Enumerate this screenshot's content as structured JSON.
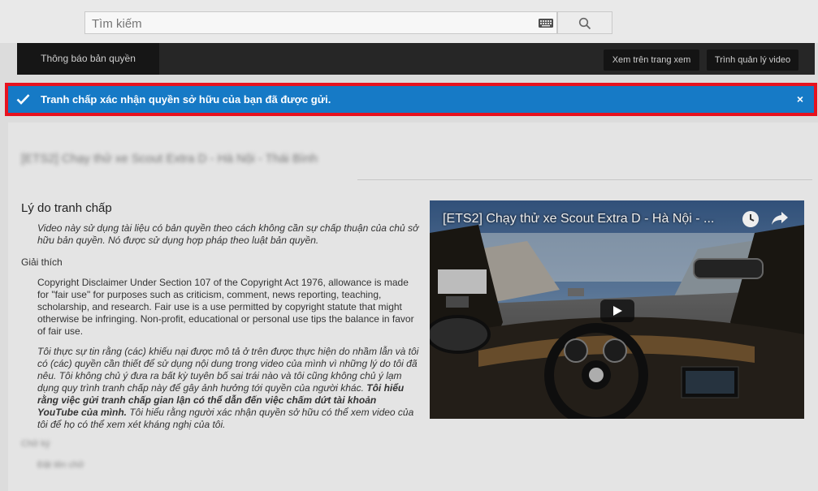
{
  "search": {
    "placeholder": "Tìm kiếm"
  },
  "nav": {
    "active_tab": "Thông báo bản quyền",
    "view_on_watch": "Xem trên trang xem",
    "video_manager": "Trình quản lý video"
  },
  "alert": {
    "message": "Tranh chấp xác nhận quyền sở hữu của bạn đã được gửi.",
    "close": "×"
  },
  "page": {
    "blurred_title": "[ETS2] Chạy thử xe Scout Extra D - Hà Nội - Thái Bình",
    "section_title": "Lý do tranh chấp",
    "reason_text": "Video này sử dụng tài liệu có bản quyền theo cách không cần sự chấp thuận của chủ sở hữu bản quyền. Nó được sử dụng hợp pháp theo luật bản quyền.",
    "explanation_label": "Giải thích",
    "explanation_text": "Copyright Disclaimer Under Section 107 of the Copyright Act 1976, allowance is made for \"fair use\" for purposes such as criticism, comment, news reporting, teaching, scholarship, and research. Fair use is a use permitted by copyright statute that might otherwise be infringing. Non-profit, educational or personal use tips the balance in favor of fair use.",
    "declaration_part1": "Tôi thực sự tin rằng (các) khiếu nại được mô tả ở trên được thực hiện do nhầm lẫn và tôi có (các) quyền cần thiết để sử dụng nội dung trong video của mình vì những lý do tôi đã nêu. Tôi không chủ ý đưa ra bất kỳ tuyên bố sai trái nào và tôi cũng không chủ ý lạm dụng quy trình tranh chấp này để gây ảnh hưởng tới quyền của người khác. ",
    "declaration_bold": "Tôi hiểu rằng việc gửi tranh chấp gian lận có thể dẫn đến việc chấm dứt tài khoản YouTube của mình.",
    "declaration_part2": " Tôi hiểu rằng người xác nhận quyền sở hữu có thể xem video của tôi để họ có thể xem xét kháng nghị của tôi.",
    "blurred_label": "Chữ ký",
    "blurred_value": "Đặt tên chữ"
  },
  "video": {
    "title": "[ETS2] Chạy thử xe Scout Extra D - Hà Nội - ..."
  },
  "colors": {
    "alert_bg": "#167ac6",
    "highlight": "#e8121e"
  }
}
